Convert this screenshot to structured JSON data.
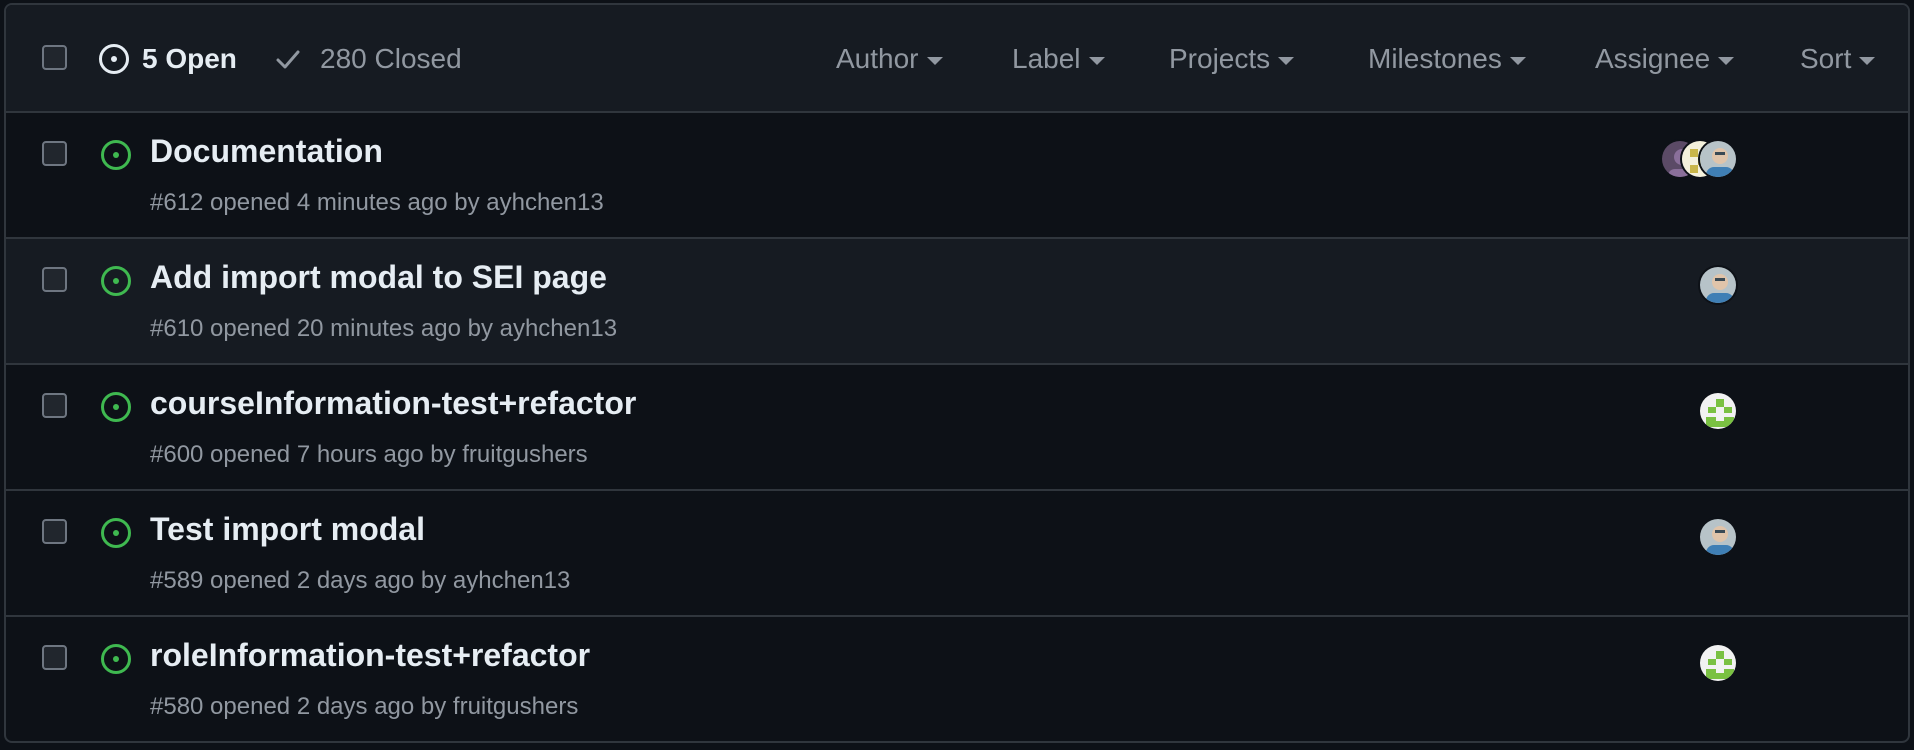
{
  "header": {
    "open_label": "5 Open",
    "closed_label": "280 Closed",
    "filters": [
      {
        "label": "Author"
      },
      {
        "label": "Label"
      },
      {
        "label": "Projects"
      },
      {
        "label": "Milestones"
      },
      {
        "label": "Assignee"
      },
      {
        "label": "Sort"
      }
    ]
  },
  "colors": {
    "open_icon": "#3fb950",
    "background": "#0d1117",
    "header_bg": "#161b22",
    "border": "#30363d",
    "muted_text": "#9198a1"
  },
  "issues": [
    {
      "title": "Documentation",
      "meta": "#612 opened 4 minutes ago by ",
      "author": "ayhchen13",
      "assignees": [
        "purple-avatar",
        "yellow-identicon-avatar",
        "photo-avatar"
      ]
    },
    {
      "title": "Add import modal to SEI page",
      "meta": "#610 opened 20 minutes ago by ",
      "author": "ayhchen13",
      "assignees": [
        "photo-avatar"
      ]
    },
    {
      "title": "courseInformation-test+refactor",
      "meta": "#600 opened 7 hours ago by ",
      "author": "fruitgushers",
      "assignees": [
        "green-identicon-avatar"
      ]
    },
    {
      "title": "Test import modal",
      "meta": "#589 opened 2 days ago by ",
      "author": "ayhchen13",
      "assignees": [
        "photo-avatar"
      ]
    },
    {
      "title": "roleInformation-test+refactor",
      "meta": "#580 opened 2 days ago by ",
      "author": "fruitgushers",
      "assignees": [
        "green-identicon-avatar"
      ]
    }
  ]
}
